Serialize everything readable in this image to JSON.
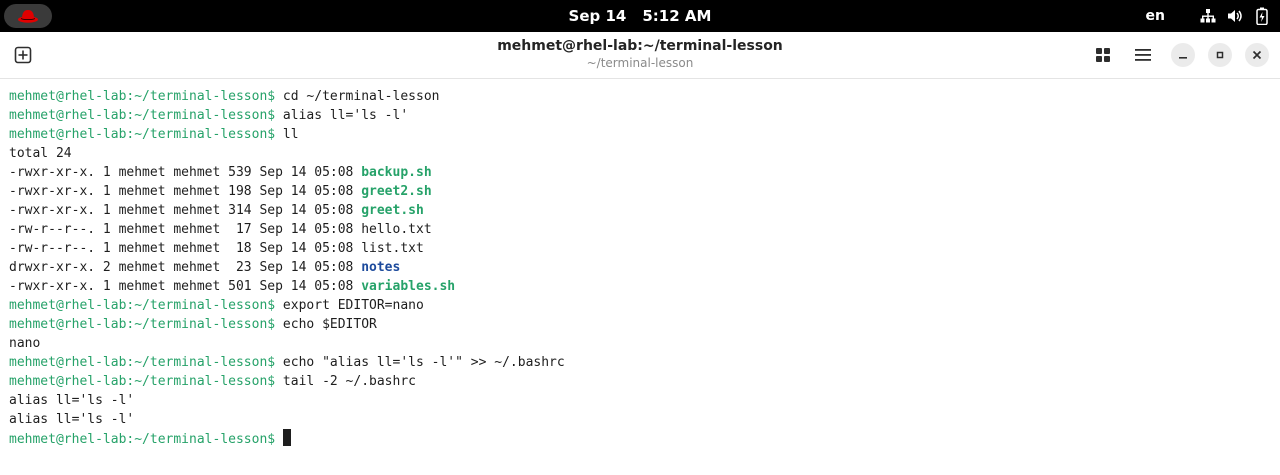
{
  "topbar": {
    "date": "Sep 14",
    "time": "5:12 AM",
    "language": "en",
    "icons": [
      "redhat-logo-icon",
      "network-icon",
      "volume-icon",
      "battery-icon"
    ]
  },
  "window": {
    "title": "mehmet@rhel-lab:~/terminal-lesson",
    "subtitle": "~/terminal-lesson"
  },
  "terminal": {
    "prompt": "mehmet@rhel-lab:~/terminal-lesson$",
    "lines": [
      {
        "type": "cmd",
        "text": " cd ~/terminal-lesson"
      },
      {
        "type": "cmd",
        "text": " alias ll='ls -l'"
      },
      {
        "type": "cmd",
        "text": " ll"
      },
      {
        "type": "out",
        "text": "total 24"
      },
      {
        "type": "ls",
        "meta": "-rwxr-xr-x. 1 mehmet mehmet 539 Sep 14 05:08 ",
        "name": "backup.sh",
        "kind": "exec"
      },
      {
        "type": "ls",
        "meta": "-rwxr-xr-x. 1 mehmet mehmet 198 Sep 14 05:08 ",
        "name": "greet2.sh",
        "kind": "exec"
      },
      {
        "type": "ls",
        "meta": "-rwxr-xr-x. 1 mehmet mehmet 314 Sep 14 05:08 ",
        "name": "greet.sh",
        "kind": "exec"
      },
      {
        "type": "ls",
        "meta": "-rw-r--r--. 1 mehmet mehmet  17 Sep 14 05:08 ",
        "name": "hello.txt",
        "kind": "file"
      },
      {
        "type": "ls",
        "meta": "-rw-r--r--. 1 mehmet mehmet  18 Sep 14 05:08 ",
        "name": "list.txt",
        "kind": "file"
      },
      {
        "type": "ls",
        "meta": "drwxr-xr-x. 2 mehmet mehmet  23 Sep 14 05:08 ",
        "name": "notes",
        "kind": "dir"
      },
      {
        "type": "ls",
        "meta": "-rwxr-xr-x. 1 mehmet mehmet 501 Sep 14 05:08 ",
        "name": "variables.sh",
        "kind": "exec"
      },
      {
        "type": "cmd",
        "text": " export EDITOR=nano"
      },
      {
        "type": "cmd",
        "text": " echo $EDITOR"
      },
      {
        "type": "out",
        "text": "nano"
      },
      {
        "type": "cmd",
        "text": " echo \"alias ll='ls -l'\" >> ~/.bashrc"
      },
      {
        "type": "cmd",
        "text": " tail -2 ~/.bashrc"
      },
      {
        "type": "out",
        "text": "alias ll='ls -l'"
      },
      {
        "type": "out",
        "text": "alias ll='ls -l'"
      },
      {
        "type": "cmd",
        "text": " ",
        "cursor": true
      }
    ]
  },
  "colors": {
    "prompt": "#26a269",
    "executable": "#26a269",
    "directory": "#1c4a9c",
    "text": "#1e1e1e"
  }
}
